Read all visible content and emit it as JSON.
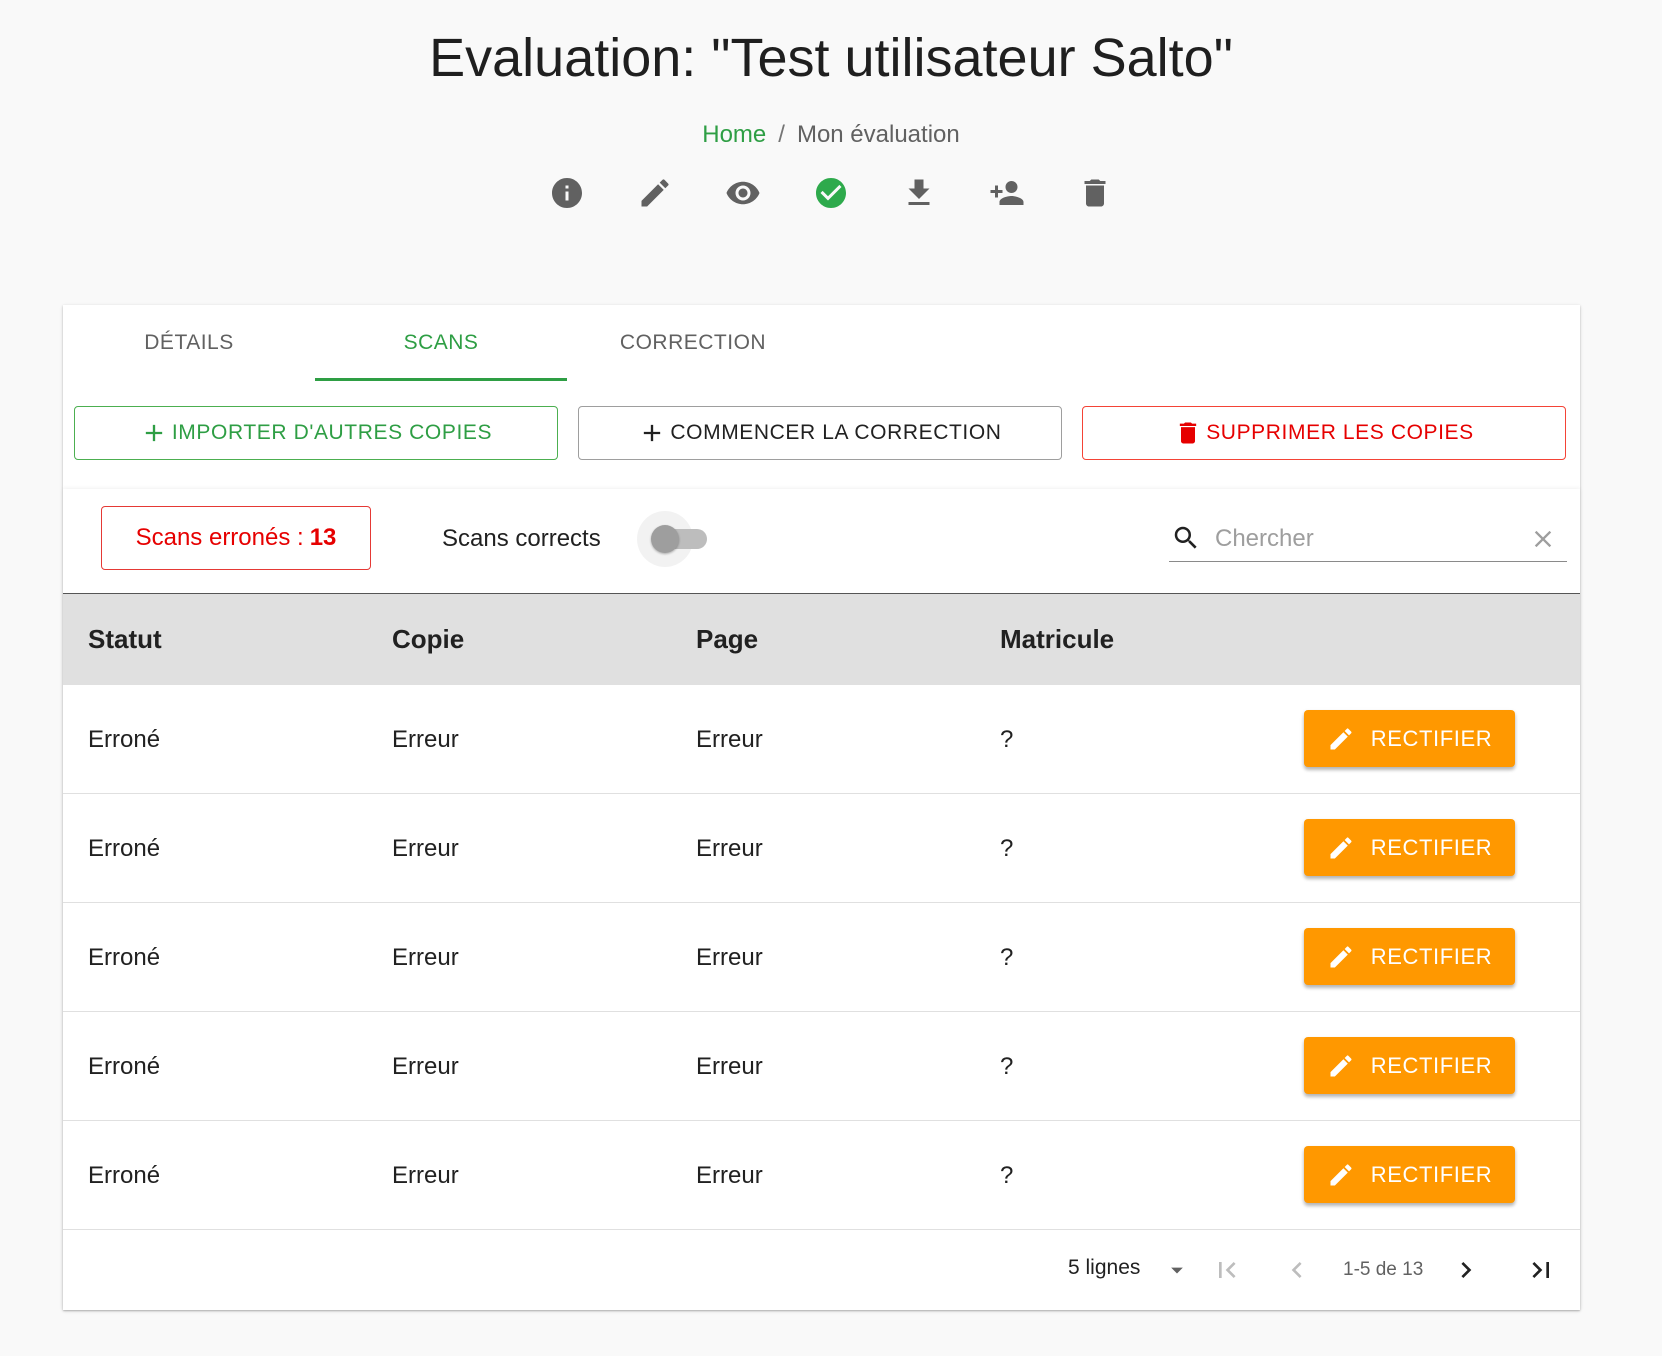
{
  "header": {
    "title": "Evaluation: \"Test utilisateur Salto\"",
    "breadcrumb": {
      "home": "Home",
      "separator": "/",
      "current": "Mon évaluation"
    },
    "actions": [
      {
        "name": "info-icon"
      },
      {
        "name": "pencil-icon"
      },
      {
        "name": "eye-icon"
      },
      {
        "name": "check-circle-icon",
        "color": "#2eaa4c"
      },
      {
        "name": "download-icon"
      },
      {
        "name": "add-person-icon"
      },
      {
        "name": "trash-icon"
      }
    ]
  },
  "tabs": [
    {
      "label": "DÉTAILS",
      "active": false
    },
    {
      "label": "SCANS",
      "active": true
    },
    {
      "label": "CORRECTION",
      "active": false
    }
  ],
  "buttons": {
    "import": "IMPORTER D'AUTRES COPIES",
    "start": "COMMENCER LA CORRECTION",
    "delete": "SUPPRIMER LES COPIES"
  },
  "toolbar": {
    "error_label": "Scans erronés :",
    "error_count": "13",
    "correct_label": "Scans corrects",
    "correct_toggle": false,
    "search_placeholder": "Chercher"
  },
  "table": {
    "columns": [
      "Statut",
      "Copie",
      "Page",
      "Matricule"
    ],
    "rows": [
      {
        "statut": "Erroné",
        "copie": "Erreur",
        "page": "Erreur",
        "matricule": "?",
        "action": "RECTIFIER"
      },
      {
        "statut": "Erroné",
        "copie": "Erreur",
        "page": "Erreur",
        "matricule": "?",
        "action": "RECTIFIER"
      },
      {
        "statut": "Erroné",
        "copie": "Erreur",
        "page": "Erreur",
        "matricule": "?",
        "action": "RECTIFIER"
      },
      {
        "statut": "Erroné",
        "copie": "Erreur",
        "page": "Erreur",
        "matricule": "?",
        "action": "RECTIFIER"
      },
      {
        "statut": "Erroné",
        "copie": "Erreur",
        "page": "Erreur",
        "matricule": "?",
        "action": "RECTIFIER"
      }
    ]
  },
  "pagination": {
    "rows_per_page": "5 lignes",
    "range": "1-5 de 13"
  },
  "colors": {
    "green": "#2e9e44",
    "red": "#e60000",
    "orange": "#ff9800"
  }
}
